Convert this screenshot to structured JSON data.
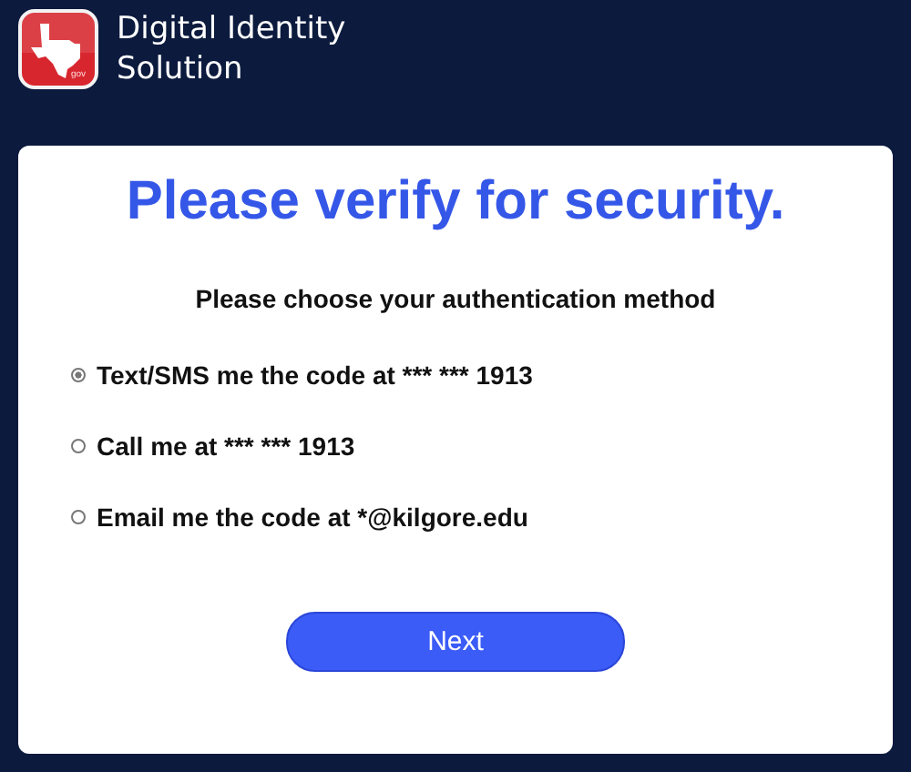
{
  "header": {
    "logo_badge": "gov",
    "title_line_1": "Digital Identity",
    "title_line_2": "Solution"
  },
  "card": {
    "heading": "Please verify for security.",
    "prompt": "Please choose your authentication method",
    "options": [
      {
        "label": "Text/SMS me the code at *** *** 1913",
        "selected": true
      },
      {
        "label": "Call me at *** *** 1913",
        "selected": false
      },
      {
        "label": "Email me the code at *@kilgore.edu",
        "selected": false
      }
    ],
    "button": "Next"
  }
}
